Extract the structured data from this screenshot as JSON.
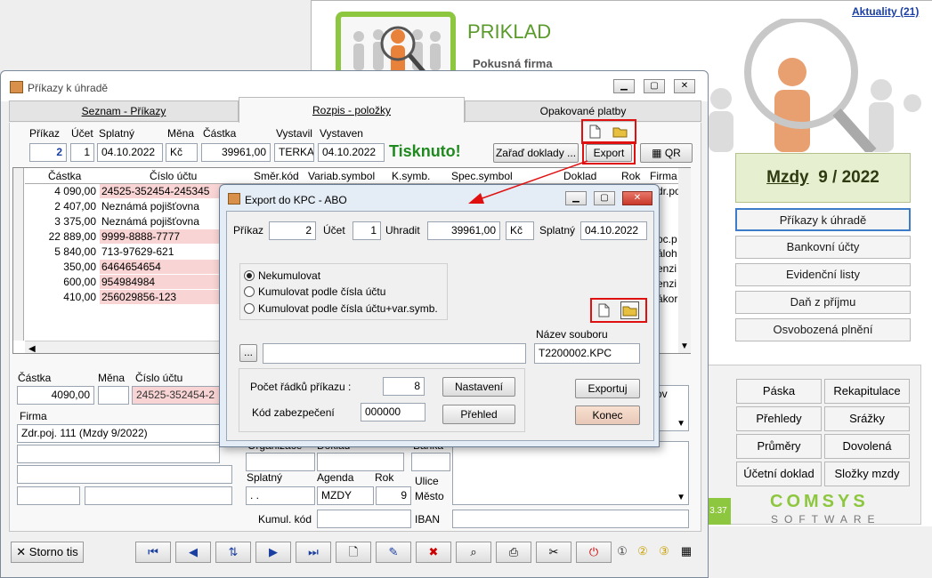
{
  "bg": {
    "news_link": "Aktuality (21)",
    "company_name": "PRIKLAD",
    "company_sub": "Pokusná firma",
    "period": "Mzdy",
    "period_value": "9 / 2022",
    "menu": [
      "Příkazy k úhradě",
      "Bankovní účty",
      "Evidenční listy",
      "Daň z příjmu",
      "Osvobozená plnění"
    ],
    "grid": [
      "Páska",
      "Rekapitulace",
      "Přehledy",
      "Srážky",
      "Průměry",
      "Dovolená",
      "Účetní doklad",
      "Složky mzdy"
    ],
    "version": "3.37",
    "brand": "COMSYS",
    "brand_sub": "SOFTWARE"
  },
  "main": {
    "title": "Příkazy k úhradě",
    "tabs": [
      "Seznam - Příkazy",
      "Rozpis - položky",
      "Opakované platby"
    ],
    "hdr": {
      "prikaz": "Příkaz",
      "ucet": "Účet",
      "splatny": "Splatný",
      "mena": "Měna",
      "castka": "Částka",
      "vystavil": "Vystavil",
      "vystaven": "Vystaven"
    },
    "vals": {
      "prikaz": "2",
      "ucet": "1",
      "splatny": "04.10.2022",
      "mena": "Kč",
      "castka": "39961,00",
      "vystavil": "TERKA",
      "vystaven": "04.10.2022"
    },
    "printed": "Tisknuto!",
    "zarad": "Zařaď doklady ...",
    "export": "Export",
    "qr": "QR",
    "cols": [
      "Částka",
      "Číslo účtu",
      "Směr.kód",
      "Variab.symbol",
      "K.symb.",
      "Spec.symbol",
      "Doklad",
      "Rok",
      "Firma"
    ],
    "rows": [
      {
        "amt": "4 090,00",
        "acc": "24525-352454-245345",
        "pink": true
      },
      {
        "amt": "2 407,00",
        "acc": "Neznámá pojišťovna",
        "pink": false
      },
      {
        "amt": "3 375,00",
        "acc": "Neznámá pojišťovna",
        "pink": false
      },
      {
        "amt": "22 889,00",
        "acc": "9999-8888-7777",
        "pink": true
      },
      {
        "amt": "5 840,00",
        "acc": "713-97629-621",
        "pink": false
      },
      {
        "amt": "350,00",
        "acc": "6464654654",
        "pink": true
      },
      {
        "amt": "600,00",
        "acc": "954984984",
        "pink": true
      },
      {
        "amt": "410,00",
        "acc": "256029856-123",
        "pink": true
      }
    ],
    "firma_col": [
      "dr.po",
      "",
      "",
      "oc.p",
      "áloh",
      "enzi",
      "enzi",
      "ákor"
    ],
    "detail": {
      "castka_lbl": "Částka",
      "mena_lbl": "Měna",
      "ucet_lbl": "Číslo účtu",
      "castka": "4090,00",
      "ucet": "24525-352454-2",
      "firma_lbl": "Firma",
      "firma": "Zdr.poj. 111 (Mzdy  9/2022)",
      "splatny_lbl": "Splatný",
      "splatny": ". .",
      "agenda_lbl": "Agenda",
      "agenda": "MZDY",
      "rok_lbl": "Rok",
      "rok": "9",
      "ulice": "Ulice",
      "mesto": "Město",
      "kumul": "Kumul. kód",
      "iban": "IBAN",
      "org": "Organizace",
      "doklad": "Doklad",
      "banka": "Banka",
      "ov": "ov"
    },
    "storno": "Storno tis"
  },
  "dialog": {
    "title": "Export do KPC - ABO",
    "prikaz_lbl": "Příkaz",
    "prikaz": "2",
    "ucet_lbl": "Účet",
    "ucet": "1",
    "uhradit_lbl": "Uhradit",
    "uhradit": "39961,00",
    "mena": "Kč",
    "splatny_lbl": "Splatný",
    "splatny": "04.10.2022",
    "options": [
      "Nekumulovat",
      "Kumulovat podle čísla účtu",
      "Kumulovat podle čísla účtu+var.symb."
    ],
    "selected_option": 0,
    "path_btn": "...",
    "file_lbl": "Název souboru",
    "file": "T2200002.KPC",
    "rows_lbl": "Počet řádků příkazu :",
    "rows": "8",
    "code_lbl": "Kód zabezpečení",
    "code": "000000",
    "nastaveni": "Nastavení",
    "prehled": "Přehled",
    "exportuj": "Exportuj",
    "konec": "Konec"
  }
}
